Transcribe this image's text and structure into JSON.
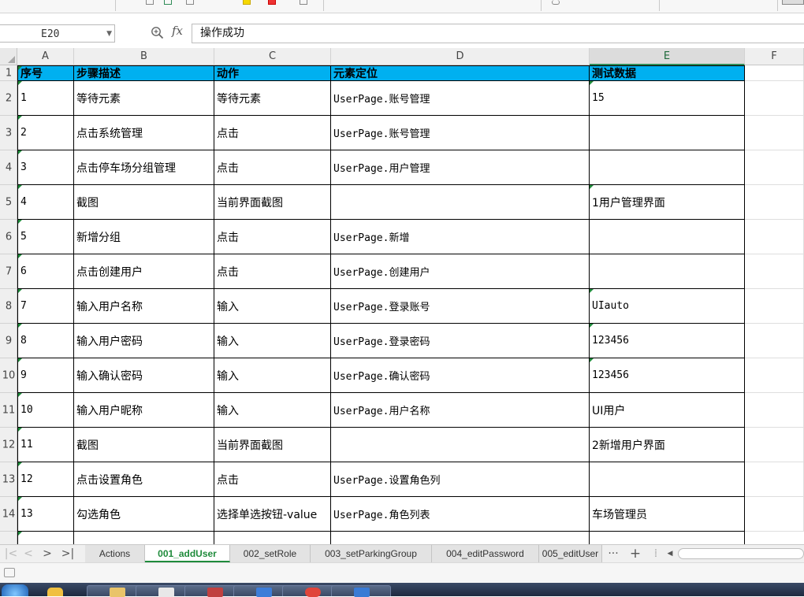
{
  "formula_bar": {
    "name_box": "E20",
    "fx_label": "fx",
    "content": "操作成功"
  },
  "columns": [
    "A",
    "B",
    "C",
    "D",
    "E",
    "F"
  ],
  "selected_column": "E",
  "rows": [
    {
      "n": "1",
      "a": "序号",
      "b": "步骤描述",
      "c": "动作",
      "d": "元素定位",
      "e": "测试数据"
    },
    {
      "n": "2",
      "a": "1",
      "b": "等待元素",
      "c": "等待元素",
      "d": "UserPage.账号管理",
      "e": "15"
    },
    {
      "n": "3",
      "a": "2",
      "b": "点击系统管理",
      "c": "点击",
      "d": "UserPage.账号管理",
      "e": ""
    },
    {
      "n": "4",
      "a": "3",
      "b": "点击停车场分组管理",
      "c": "点击",
      "d": "UserPage.用户管理",
      "e": ""
    },
    {
      "n": "5",
      "a": "4",
      "b": "截图",
      "c": "当前界面截图",
      "d": "",
      "e": "1用户管理界面"
    },
    {
      "n": "6",
      "a": "5",
      "b": "新增分组",
      "c": "点击",
      "d": "UserPage.新增",
      "e": ""
    },
    {
      "n": "7",
      "a": "6",
      "b": "点击创建用户",
      "c": "点击",
      "d": "UserPage.创建用户",
      "e": ""
    },
    {
      "n": "8",
      "a": "7",
      "b": "输入用户名称",
      "c": "输入",
      "d": "UserPage.登录账号",
      "e": "UIauto"
    },
    {
      "n": "9",
      "a": "8",
      "b": "输入用户密码",
      "c": "输入",
      "d": "UserPage.登录密码",
      "e": "123456"
    },
    {
      "n": "10",
      "a": "9",
      "b": "输入确认密码",
      "c": "输入",
      "d": "UserPage.确认密码",
      "e": "123456"
    },
    {
      "n": "11",
      "a": "10",
      "b": "输入用户昵称",
      "c": "输入",
      "d": "UserPage.用户名称",
      "e": "UI用户"
    },
    {
      "n": "12",
      "a": "11",
      "b": "截图",
      "c": "当前界面截图",
      "d": "",
      "e": "2新增用户界面"
    },
    {
      "n": "13",
      "a": "12",
      "b": "点击设置角色",
      "c": "点击",
      "d": "UserPage.设置角色列",
      "e": ""
    },
    {
      "n": "14",
      "a": "13",
      "b": "勾选角色",
      "c": "选择单选按钮-value",
      "d": "UserPage.角色列表",
      "e": "车场管理员"
    }
  ],
  "sheet_tabs": [
    "Actions",
    "001_addUser",
    "002_setRole",
    "003_setParkingGroup",
    "004_editPassword",
    "005_editUser"
  ],
  "active_sheet": "001_addUser",
  "sheet_nav": {
    "next": ">",
    "last": ">|",
    "more": "···",
    "add": "+"
  },
  "colors": {
    "header_fill": "#00b0f0",
    "active_tab": "#1f8b3b",
    "comment_marker": "#1f8b3b"
  }
}
